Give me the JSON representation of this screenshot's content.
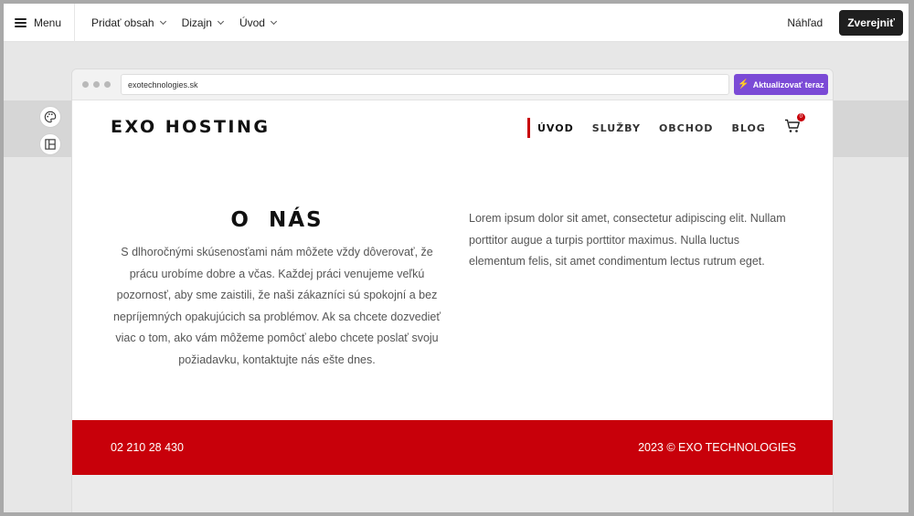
{
  "editor": {
    "menu_label": "Menu",
    "nav": [
      {
        "label": "Pridať obsah"
      },
      {
        "label": "Dizajn"
      },
      {
        "label": "Úvod"
      }
    ],
    "preview_label": "Náhľad",
    "publish_label": "Zverejniť"
  },
  "browser": {
    "url": "exotechnologies.sk",
    "update_label": "Aktualizovať teraz",
    "accent": "#7b4ad6"
  },
  "site": {
    "logo": "EXO HOSTING",
    "nav": [
      {
        "label": "ÚVOD",
        "active": true
      },
      {
        "label": "SLUŽBY"
      },
      {
        "label": "OBCHOD"
      },
      {
        "label": "BLOG"
      }
    ],
    "cart_count": "0",
    "about": {
      "title": "O NÁS",
      "text": "S dlhoročnými skúsenosťami nám môžete vždy dôverovať, že prácu urobíme dobre a včas. Každej práci venujeme veľkú pozornosť, aby sme zaistili, že naši zákazníci sú spokojní a bez nepríjemných opakujúcich sa problémov. Ak sa chcete dozvedieť viac o tom, ako vám môžeme pomôcť alebo chcete poslať svoju požiadavku, kontaktujte nás ešte dnes."
    },
    "lorem": "Lorem ipsum dolor sit amet, consectetur adipiscing elit. Nullam porttitor augue a turpis porttitor maximus. Nulla luctus elementum felis, sit amet condimentum lectus rutrum eget.",
    "footer": {
      "phone": "02 210 28 430",
      "copyright": "2023 © EXO TECHNOLOGIES"
    },
    "brand_color": "#c8000a"
  }
}
